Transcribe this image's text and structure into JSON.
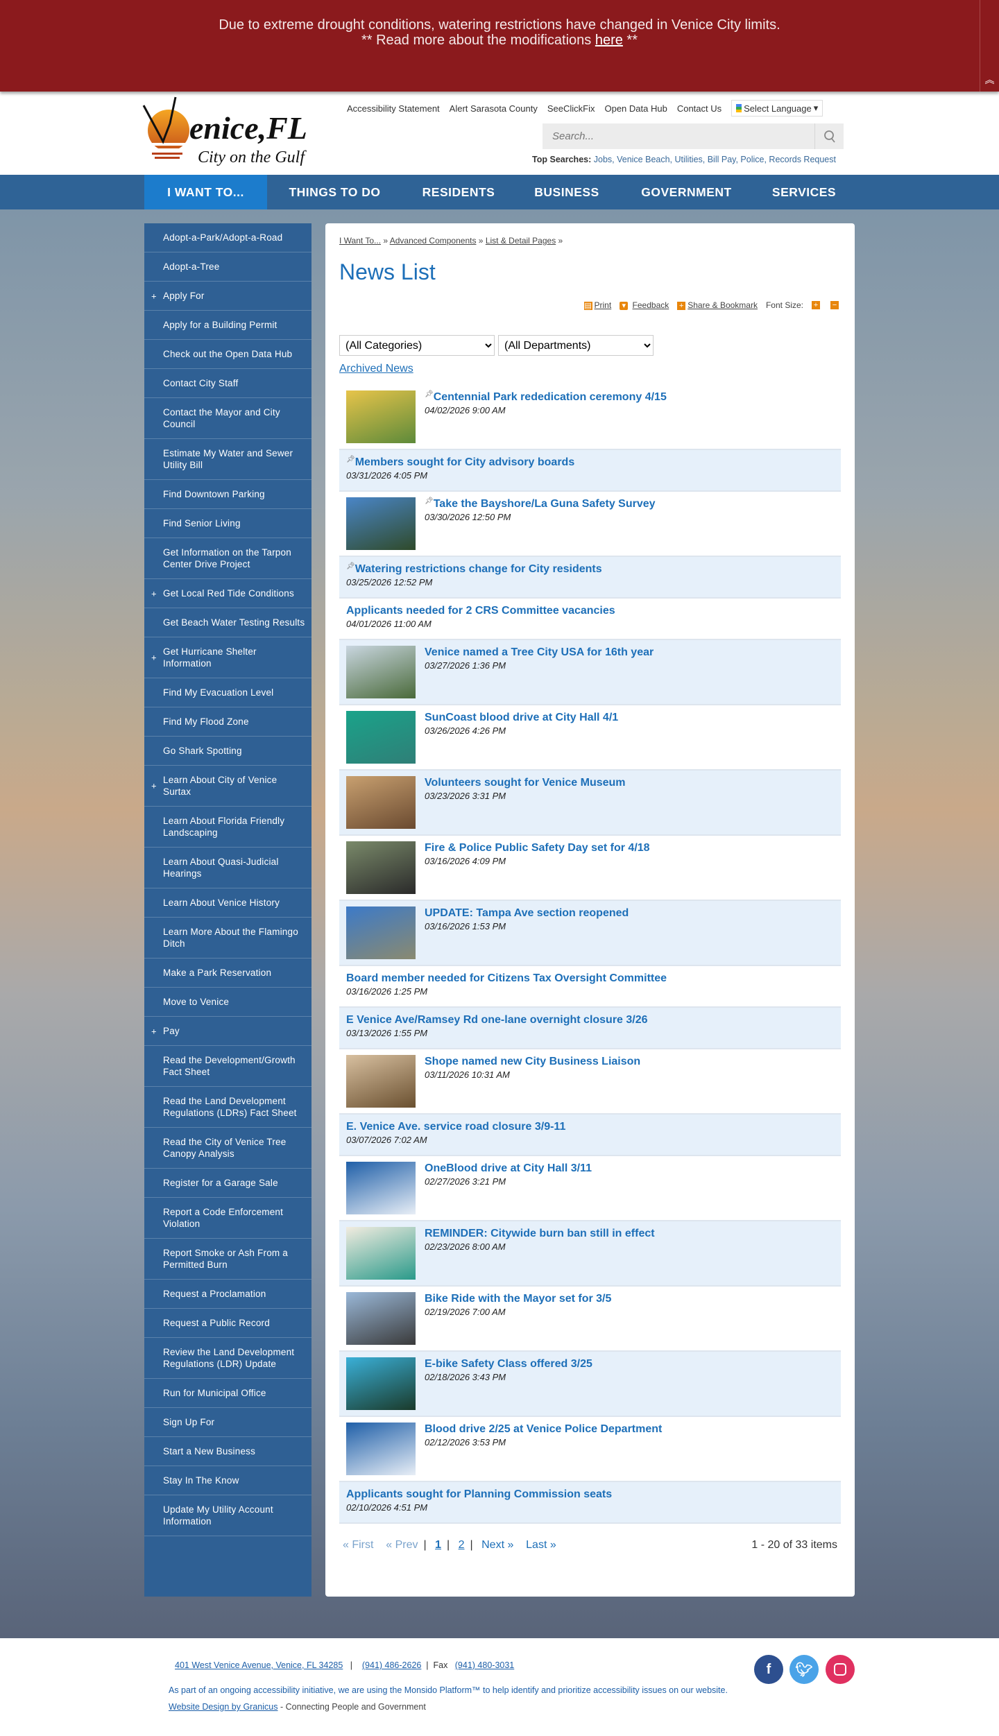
{
  "banner": {
    "line1": "Due to extreme drought conditions, watering restrictions have changed in Venice City limits.",
    "line2_prefix": "** Read more about the modifications ",
    "link": "here",
    "line2_suffix": " **"
  },
  "logo": {
    "text": "Venice,FL",
    "tagline": "City on the Gulf"
  },
  "utility_links": [
    "Accessibility Statement",
    "Alert Sarasota County",
    "SeeClickFix",
    "Open Data Hub",
    "Contact Us"
  ],
  "language": "Select Language",
  "search": {
    "placeholder": "Search..."
  },
  "top_searches": {
    "label": "Top Searches:",
    "links": "Jobs, Venice Beach, Utilities, Bill Pay, Police, Records Request"
  },
  "nav": [
    "I WANT TO...",
    "THINGS TO DO",
    "RESIDENTS",
    "BUSINESS",
    "GOVERNMENT",
    "SERVICES"
  ],
  "sidebar": [
    {
      "label": "Adopt-a-Park/Adopt-a-Road"
    },
    {
      "label": "Adopt-a-Tree"
    },
    {
      "label": "Apply For",
      "expand": true
    },
    {
      "label": "Apply for a Building Permit"
    },
    {
      "label": "Check out the Open Data Hub"
    },
    {
      "label": "Contact City Staff"
    },
    {
      "label": "Contact the Mayor and City Council"
    },
    {
      "label": "Estimate My Water and Sewer Utility Bill"
    },
    {
      "label": "Find Downtown Parking"
    },
    {
      "label": "Find Senior Living"
    },
    {
      "label": "Get Information on the Tarpon Center Drive Project"
    },
    {
      "label": "Get Local Red Tide Conditions",
      "expand": true
    },
    {
      "label": "Get Beach Water Testing Results"
    },
    {
      "label": "Get Hurricane Shelter Information",
      "expand": true
    },
    {
      "label": "Find My Evacuation Level"
    },
    {
      "label": "Find My Flood Zone"
    },
    {
      "label": "Go Shark Spotting"
    },
    {
      "label": "Learn About City of Venice Surtax",
      "expand": true
    },
    {
      "label": "Learn About Florida Friendly Landscaping"
    },
    {
      "label": "Learn About Quasi-Judicial Hearings"
    },
    {
      "label": "Learn About Venice History"
    },
    {
      "label": "Learn More About the Flamingo Ditch"
    },
    {
      "label": "Make a Park Reservation"
    },
    {
      "label": "Move to Venice"
    },
    {
      "label": "Pay",
      "expand": true
    },
    {
      "label": "Read the Development/Growth Fact Sheet"
    },
    {
      "label": "Read the Land Development Regulations (LDRs) Fact Sheet"
    },
    {
      "label": "Read the City of Venice Tree Canopy Analysis"
    },
    {
      "label": "Register for a Garage Sale"
    },
    {
      "label": "Report a Code Enforcement Violation"
    },
    {
      "label": "Report Smoke or Ash From a Permitted Burn"
    },
    {
      "label": "Request a Proclamation"
    },
    {
      "label": "Request a Public Record"
    },
    {
      "label": "Review the Land Development Regulations (LDR) Update"
    },
    {
      "label": "Run for Municipal Office"
    },
    {
      "label": "Sign Up For"
    },
    {
      "label": "Start a New Business"
    },
    {
      "label": "Stay In The Know"
    },
    {
      "label": "Update My Utility Account Information"
    }
  ],
  "breadcrumb": [
    "I Want To...",
    "Advanced Components",
    "List & Detail Pages"
  ],
  "page_title": "News List",
  "tools": {
    "print": "Print",
    "feedback": "Feedback",
    "share": "Share & Bookmark",
    "font_size": "Font Size:"
  },
  "filters": {
    "category": "(All Categories)",
    "department": "(All Departments)"
  },
  "archived": "Archived News",
  "news": [
    {
      "title": "Centennial Park rededication ceremony 4/15",
      "date": "04/02/2026 9:00 AM",
      "pinned": true,
      "thumb": [
        "#e7c44a",
        "#5d8a3a"
      ]
    },
    {
      "title": "Members sought for City advisory boards",
      "date": "03/31/2026 4:05 PM",
      "pinned": true
    },
    {
      "title": "Take the Bayshore/La Guna Safety Survey",
      "date": "03/30/2026 12:50 PM",
      "pinned": true,
      "thumb": [
        "#4a86c8",
        "#2f4a2a"
      ]
    },
    {
      "title": "Watering restrictions change for City residents",
      "date": "03/25/2026 12:52 PM",
      "pinned": true
    },
    {
      "title": "Applicants needed for 2 CRS Committee vacancies",
      "date": "04/01/2026 11:00 AM"
    },
    {
      "title": "Venice named a Tree City USA for 16th year",
      "date": "03/27/2026 1:36 PM",
      "thumb": [
        "#c9d6e0",
        "#4a6a3a"
      ]
    },
    {
      "title": "SunCoast blood drive at City Hall 4/1",
      "date": "03/26/2026 4:26 PM",
      "thumb": [
        "#1aa38a",
        "#2f7f77"
      ]
    },
    {
      "title": "Volunteers sought for Venice Museum",
      "date": "03/23/2026 3:31 PM",
      "thumb": [
        "#c8a070",
        "#6a4a30"
      ]
    },
    {
      "title": "Fire & Police Public Safety Day set for 4/18",
      "date": "03/16/2026 4:09 PM",
      "thumb": [
        "#7a8a6a",
        "#2a2a2a"
      ]
    },
    {
      "title": "UPDATE: Tampa Ave section reopened",
      "date": "03/16/2026 1:53 PM",
      "thumb": [
        "#3c7ac8",
        "#8a8a70"
      ]
    },
    {
      "title": "Board member needed for Citizens Tax Oversight Committee",
      "date": "03/16/2026 1:25 PM"
    },
    {
      "title": "E Venice Ave/Ramsey Rd one-lane overnight closure 3/26",
      "date": "03/13/2026 1:55 PM"
    },
    {
      "title": "Shope named new City Business Liaison",
      "date": "03/11/2026 10:31 AM",
      "thumb": [
        "#d8c0a0",
        "#6a5030"
      ]
    },
    {
      "title": "E. Venice Ave. service road closure 3/9-11",
      "date": "03/07/2026 7:02 AM"
    },
    {
      "title": "OneBlood drive at City Hall 3/11",
      "date": "02/27/2026 3:21 PM",
      "thumb": [
        "#1f5fa8",
        "#e8eef6"
      ]
    },
    {
      "title": "REMINDER: Citywide burn ban still in effect",
      "date": "02/23/2026 8:00 AM",
      "thumb": [
        "#f2ece0",
        "#2a9a8a"
      ]
    },
    {
      "title": "Bike Ride with the Mayor set for 3/5",
      "date": "02/19/2026 7:00 AM",
      "thumb": [
        "#9ab8d8",
        "#3a3a3a"
      ]
    },
    {
      "title": "E-bike Safety Class offered 3/25",
      "date": "02/18/2026 3:43 PM",
      "thumb": [
        "#3ab0d8",
        "#1a3a2a"
      ]
    },
    {
      "title": "Blood drive 2/25 at Venice Police Department",
      "date": "02/12/2026 3:53 PM",
      "thumb": [
        "#1f5fa8",
        "#e8eef6"
      ]
    },
    {
      "title": "Applicants sought for Planning Commission seats",
      "date": "02/10/2026 4:51 PM"
    }
  ],
  "pager": {
    "first": "« First",
    "prev": "« Prev",
    "pages": [
      "1",
      "2"
    ],
    "next": "Next »",
    "last": "Last »",
    "summary": "1 - 20 of 33 items"
  },
  "footer": {
    "address": "401 West Venice Avenue, Venice, FL 34285",
    "phone": "(941) 486-2626",
    "fax_label": "Fax",
    "fax": "(941) 480-3031",
    "accessibility": "As part of an ongoing accessibility initiative, we are using the Monsido Platform™ to help identify and prioritize accessibility issues on our website.",
    "design_link": "Website Design by Granicus",
    "design_suffix": " - Connecting People and Government"
  }
}
